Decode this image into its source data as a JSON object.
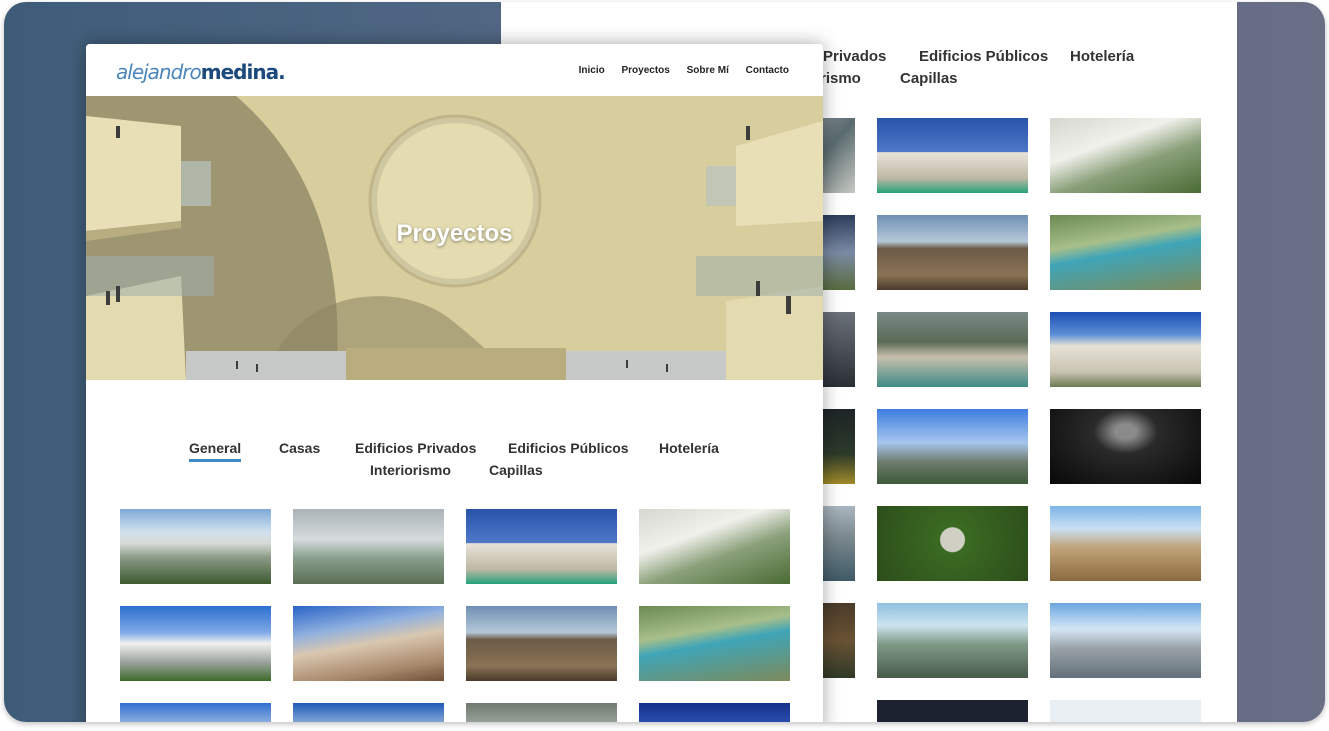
{
  "brand": {
    "logo_thin": "alejandro",
    "logo_bold": "medina."
  },
  "nav": {
    "items": [
      "Inicio",
      "Proyectos",
      "Sobre Mí",
      "Contacto"
    ]
  },
  "hero": {
    "title": "Proyectos"
  },
  "tabs": {
    "items": [
      "General",
      "Casas",
      "Edificios Privados",
      "Edificios Públicos",
      "Hotelería",
      "Interiorismo",
      "Capillas"
    ],
    "active": "General"
  },
  "back_tabs": {
    "items": [
      "Privados",
      "Edificios Públicos",
      "Hotelería",
      "rismo",
      "Capillas"
    ]
  },
  "colors": {
    "accent": "#3f8ac4",
    "background_left": "#3e5c78",
    "background_right": "#6a6f86"
  }
}
